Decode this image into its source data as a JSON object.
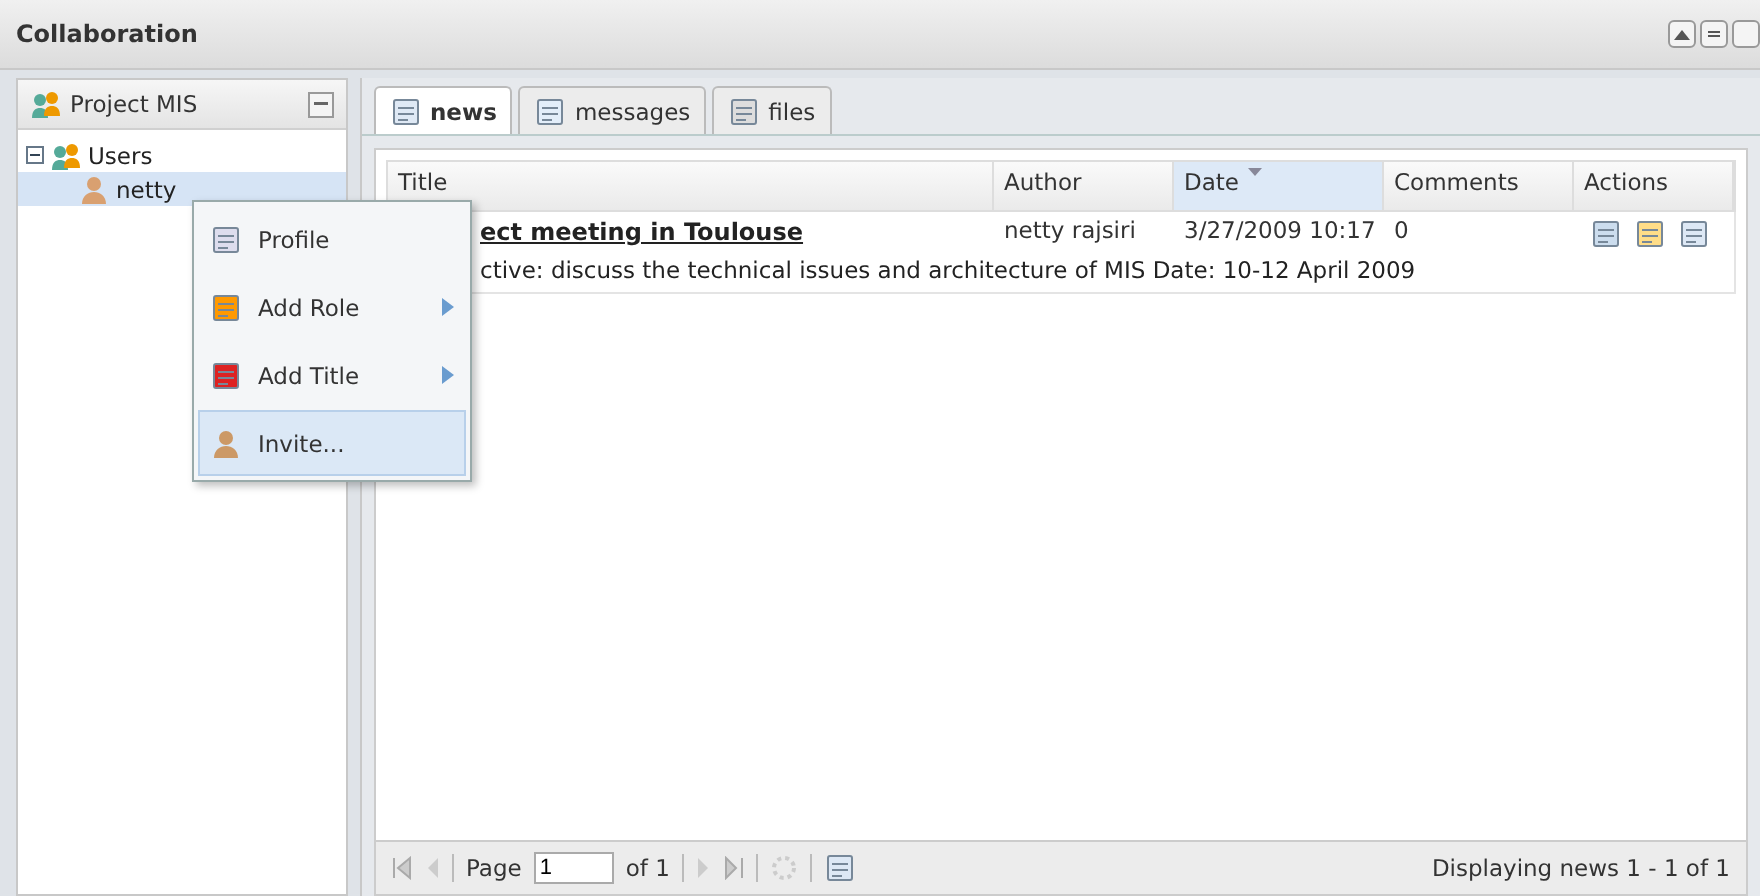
{
  "window": {
    "title": "Collaboration"
  },
  "sidebar": {
    "title": "Project MIS",
    "tree": [
      {
        "label": "Users",
        "expanded": true,
        "selected": false,
        "children": [
          {
            "label": "netty",
            "selected": true
          }
        ]
      }
    ]
  },
  "context_menu": [
    {
      "label": "Profile",
      "kind": "profile",
      "submenu": false,
      "selected": false
    },
    {
      "label": "Add Role",
      "kind": "role",
      "submenu": true,
      "selected": false
    },
    {
      "label": "Add Title",
      "kind": "title",
      "submenu": true,
      "selected": false
    },
    {
      "label": "Invite...",
      "kind": "invite",
      "submenu": false,
      "selected": true
    }
  ],
  "tabs": [
    {
      "label": "news",
      "kind": "news",
      "selected": true
    },
    {
      "label": "messages",
      "kind": "messages",
      "selected": false
    },
    {
      "label": "files",
      "kind": "files",
      "selected": false
    }
  ],
  "table": {
    "columns": [
      {
        "label": "Title"
      },
      {
        "label": "Author"
      },
      {
        "label": "Date",
        "sorted": true
      },
      {
        "label": "Comments"
      },
      {
        "label": "Actions"
      }
    ],
    "rows": [
      {
        "title": "ect meeting in Toulouse",
        "author": "netty rajsiri",
        "date": "3/27/2009 10:17",
        "comments": "0",
        "body": "ctive: discuss the technical issues and architecture of MIS Date: 10-12 April 2009"
      }
    ]
  },
  "pager": {
    "page_label": "Page",
    "page": "1",
    "of": "of 1",
    "status": "Displaying news 1 - 1 of 1"
  }
}
